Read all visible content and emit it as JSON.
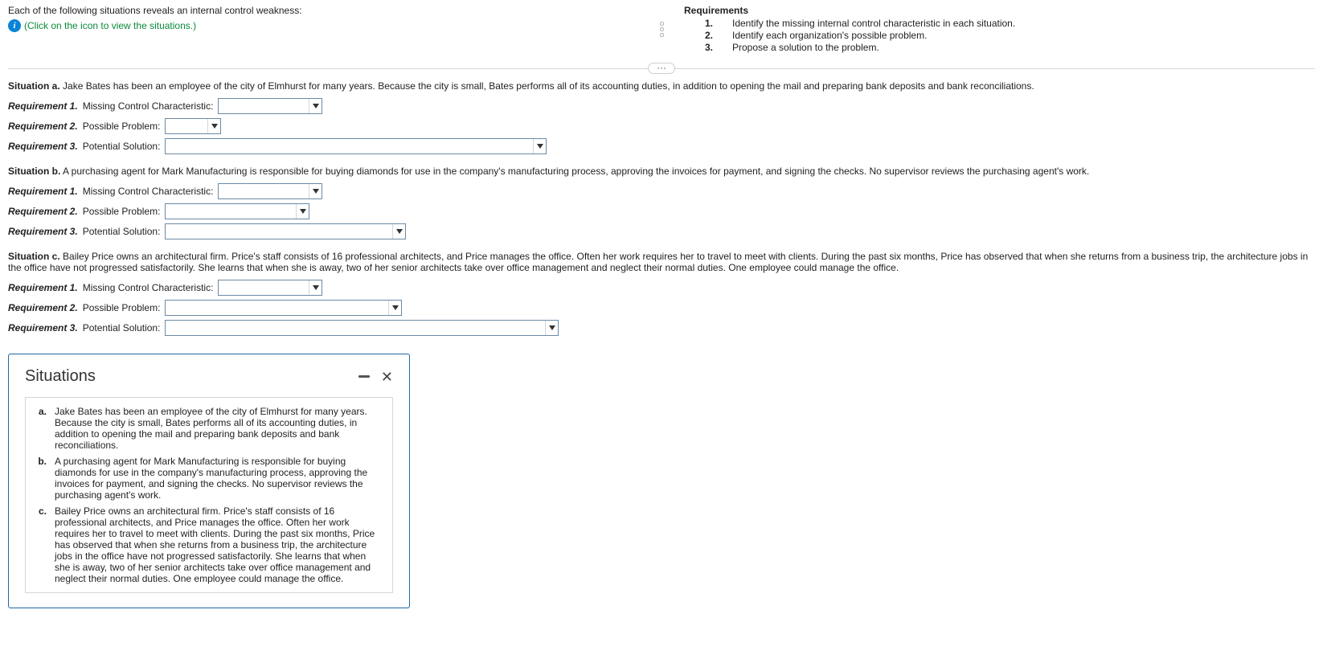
{
  "header": {
    "intro": "Each of the following situations reveals an internal control weakness:",
    "info_text": "(Click on the icon to view the situations.)",
    "requirements_label": "Requirements",
    "requirements": [
      {
        "n": "1.",
        "text": "Identify the missing internal control characteristic in each situation."
      },
      {
        "n": "2.",
        "text": "Identify each organization's possible problem."
      },
      {
        "n": "3.",
        "text": "Propose a solution to the problem."
      }
    ]
  },
  "labels": {
    "req1_b": "Requirement 1.",
    "req2_b": "Requirement 2.",
    "req3_b": "Requirement 3.",
    "missing": "Missing Control Characteristic:",
    "possible": "Possible Problem:",
    "potential": "Potential Solution:"
  },
  "situations": {
    "a": {
      "label": "Situation a.",
      "text": "Jake Bates has been an employee of the city of Elmhurst for many years. Because the city is small, Bates performs all of its accounting duties, in addition to opening the mail and preparing bank deposits and bank reconciliations."
    },
    "b": {
      "label": "Situation b.",
      "text": "A purchasing agent for Mark Manufacturing is responsible for buying diamonds for use in the company's manufacturing process, approving the invoices for payment, and signing the checks. No supervisor reviews the purchasing agent's work."
    },
    "c": {
      "label": "Situation c.",
      "text": "Bailey Price owns an architectural firm. Price's staff consists of 16 professional architects, and Price manages the office. Often her work requires her to travel to meet with clients. During the past six months, Price has observed that when she returns from a business trip, the architecture jobs in the office have not progressed satisfactorily. She learns that when she is away, two of her senior architects take over office management and neglect their normal duties. One employee could manage the office."
    }
  },
  "dialog": {
    "title": "Situations",
    "items": [
      {
        "letter": "a.",
        "text": "Jake Bates has been an employee of the city of Elmhurst for many years. Because the city is small, Bates performs all of its accounting duties, in addition to opening the mail and preparing bank deposits and bank reconciliations."
      },
      {
        "letter": "b.",
        "text": "A purchasing agent for Mark Manufacturing is responsible for buying diamonds for use in the company's manufacturing process, approving the invoices for payment, and signing the checks. No supervisor reviews the purchasing agent's work."
      },
      {
        "letter": "c.",
        "text": "Bailey Price owns an architectural firm. Price's staff consists of 16 professional architects, and Price manages the office. Often her work requires her to travel to meet with clients. During the past six months, Price has observed that when she returns from a business trip, the architecture jobs in the office have not progressed satisfactorily. She learns that when she is away, two of her senior architects take over office management and neglect their normal duties. One employee could manage the office."
      }
    ]
  }
}
